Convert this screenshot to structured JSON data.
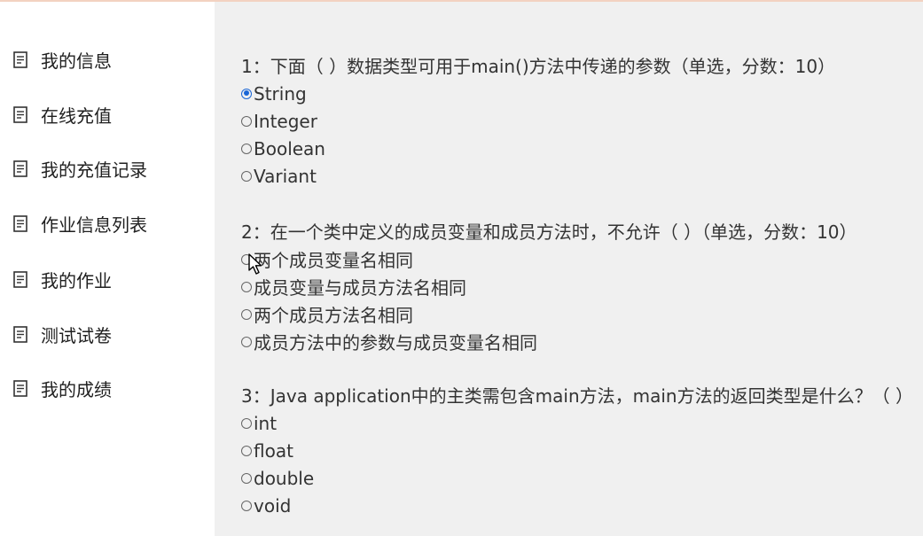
{
  "sidebar": {
    "items": [
      {
        "label": "我的信息",
        "icon": "document-icon"
      },
      {
        "label": "在线充值",
        "icon": "document-icon"
      },
      {
        "label": "我的充值记录",
        "icon": "document-icon"
      },
      {
        "label": "作业信息列表",
        "icon": "document-icon"
      },
      {
        "label": "我的作业",
        "icon": "document-icon"
      },
      {
        "label": "测试试卷",
        "icon": "document-icon"
      },
      {
        "label": "我的成绩",
        "icon": "document-icon"
      }
    ]
  },
  "questions": [
    {
      "title": "1：下面（  ）数据类型可用于main()方法中传递的参数（单选，分数：10）",
      "options": [
        {
          "label": "String",
          "checked": true
        },
        {
          "label": "Integer",
          "checked": false
        },
        {
          "label": "Boolean",
          "checked": false
        },
        {
          "label": "Variant",
          "checked": false
        }
      ]
    },
    {
      "title": "2：在一个类中定义的成员变量和成员方法时，不允许（  ）（单选，分数：10）",
      "options": [
        {
          "label": "两个成员变量名相同",
          "checked": false
        },
        {
          "label": "成员变量与成员方法名相同",
          "checked": false
        },
        {
          "label": "两个成员方法名相同",
          "checked": false
        },
        {
          "label": "成员方法中的参数与成员变量名相同",
          "checked": false
        }
      ]
    },
    {
      "title": "3：Java application中的主类需包含main方法，main方法的返回类型是什么？（  ）",
      "options": [
        {
          "label": "int",
          "checked": false
        },
        {
          "label": "float",
          "checked": false
        },
        {
          "label": "double",
          "checked": false
        },
        {
          "label": "void",
          "checked": false
        }
      ]
    }
  ],
  "colors": {
    "sidebar_bg": "#ffffff",
    "content_bg": "#f0f0f0",
    "selected_radio": "#1a66d6"
  }
}
